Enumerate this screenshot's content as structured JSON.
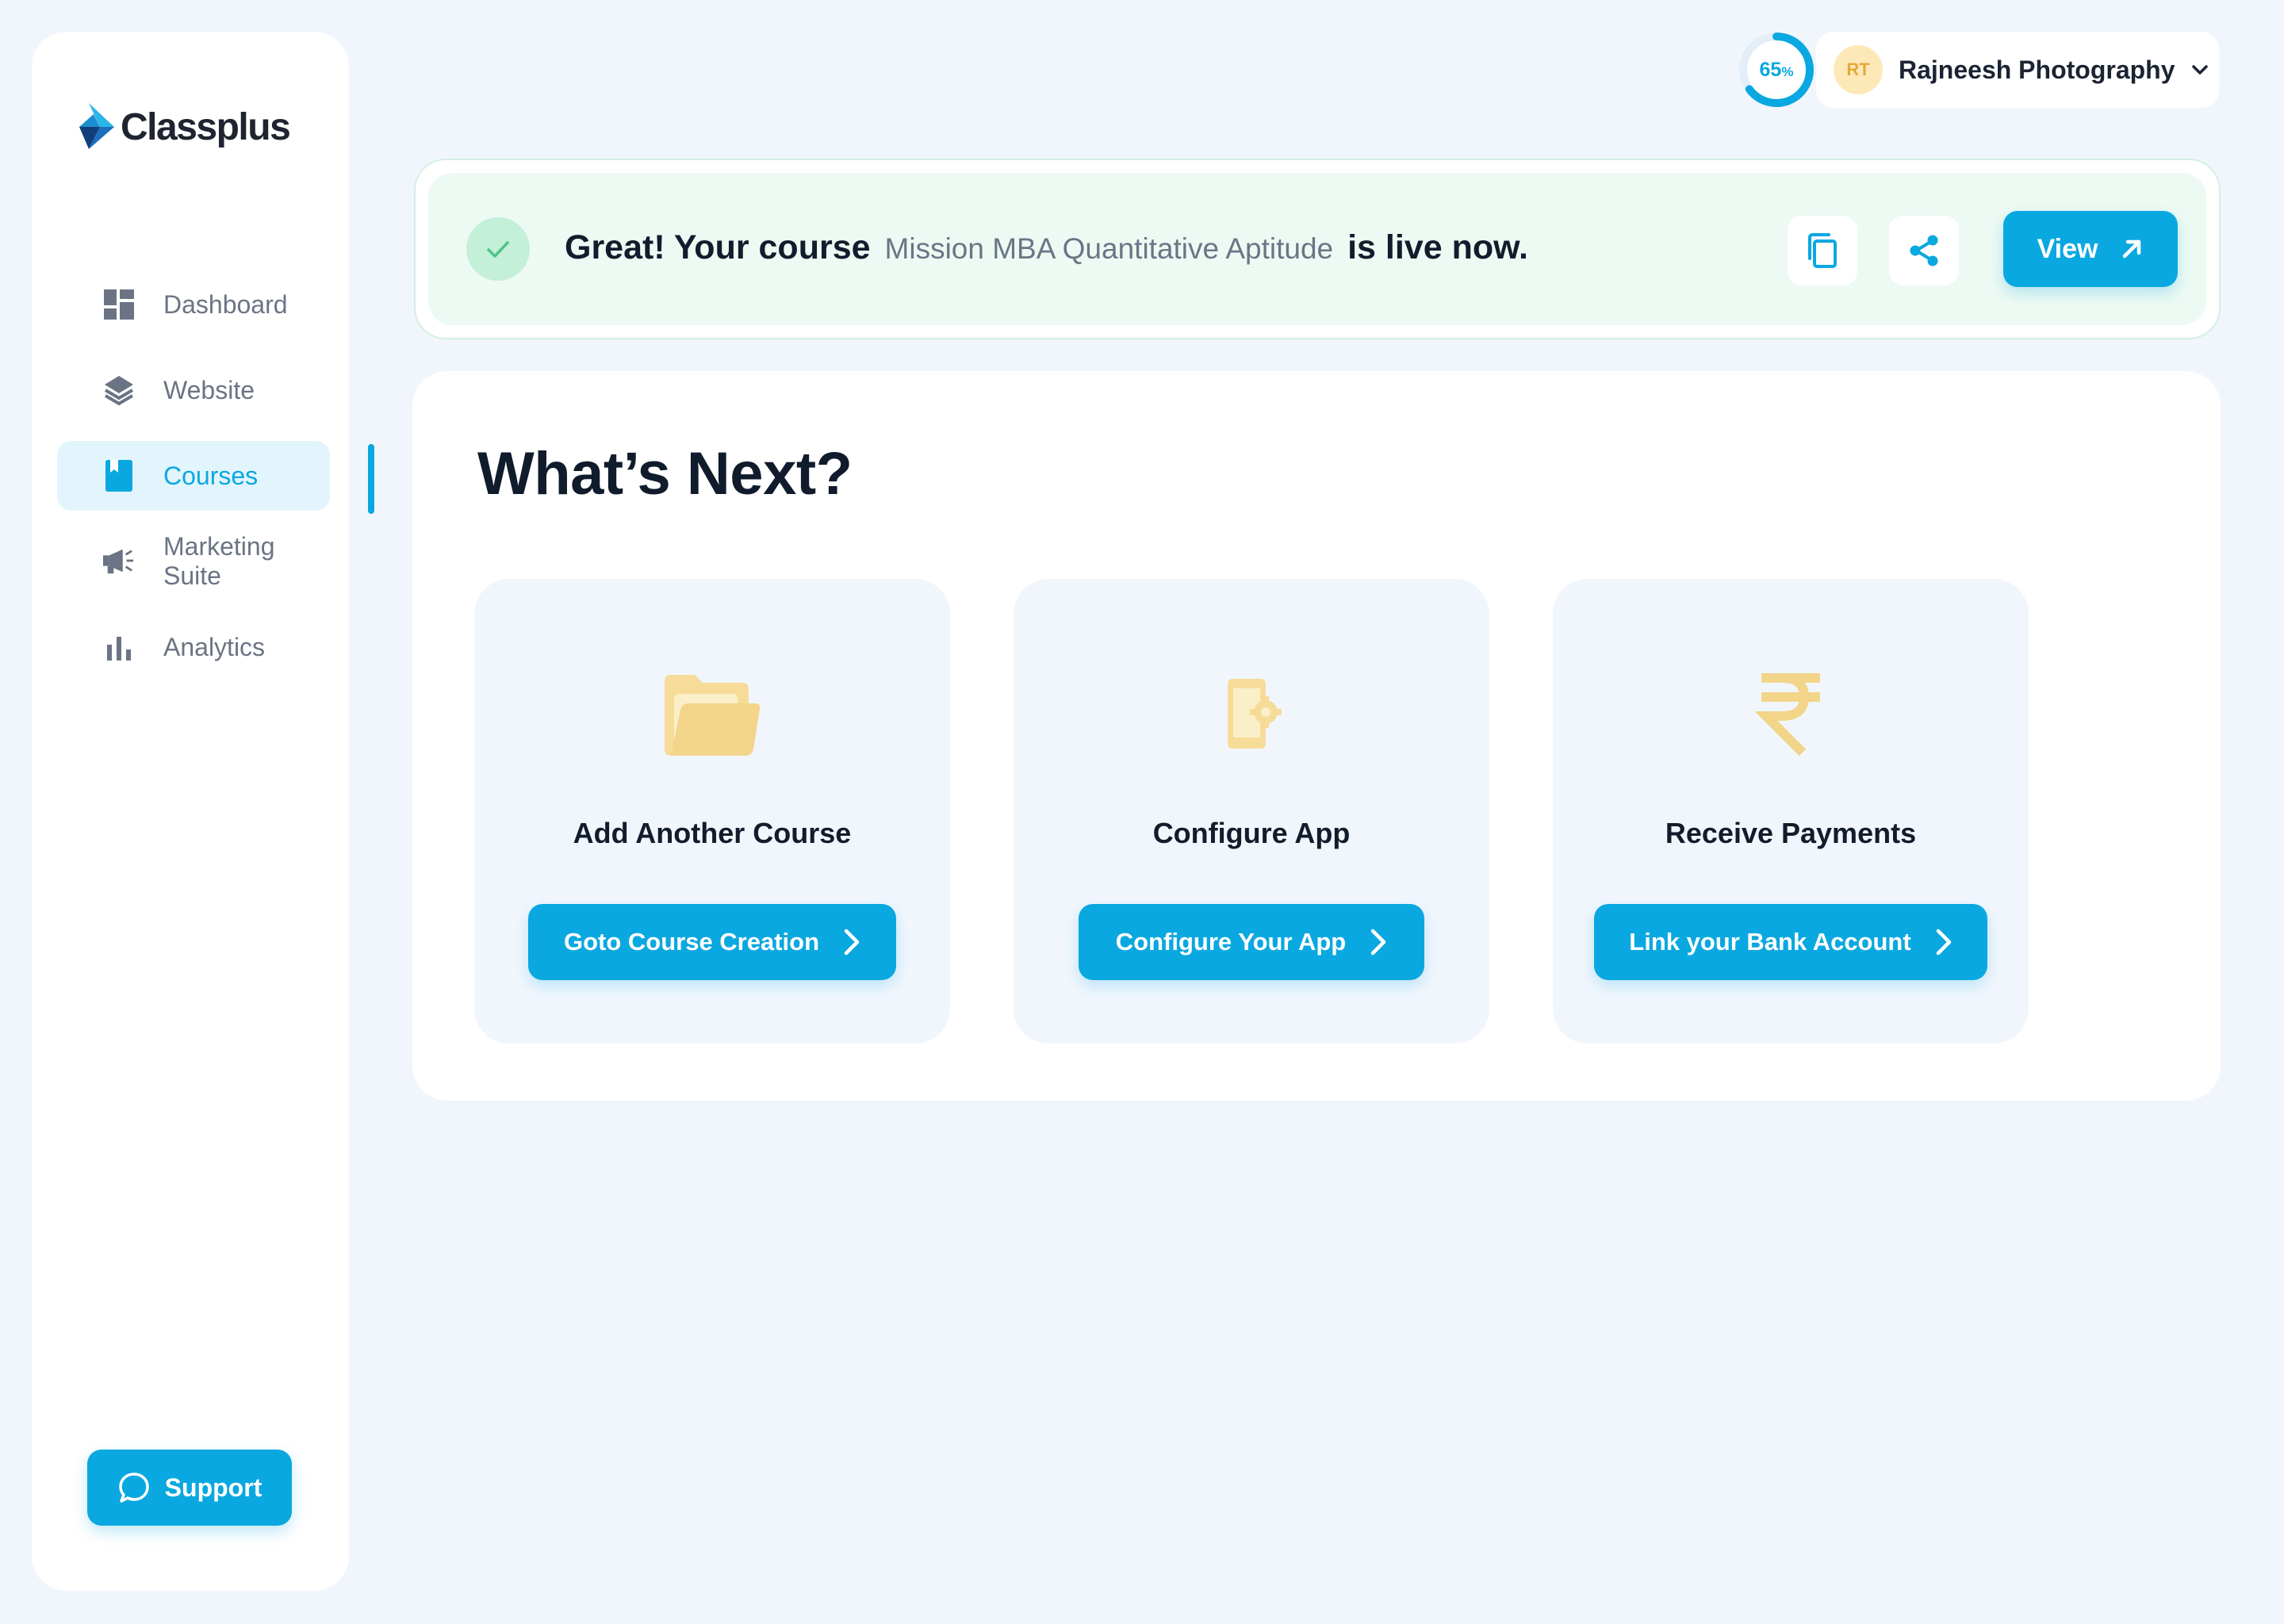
{
  "app": {
    "brand": "Classplus"
  },
  "sidebar": {
    "items": [
      {
        "label": "Dashboard",
        "icon": "dashboard-icon"
      },
      {
        "label": "Website",
        "icon": "layers-icon"
      },
      {
        "label": "Courses",
        "icon": "book-icon",
        "active": true
      },
      {
        "label": "Marketing Suite",
        "icon": "megaphone-icon"
      },
      {
        "label": "Analytics",
        "icon": "bar-chart-icon"
      }
    ],
    "support_label": "Support"
  },
  "header": {
    "progress_value": "65",
    "progress_unit": "%",
    "progress_fraction": 0.65,
    "user_initials": "RT",
    "user_name": "Rajneesh Photography"
  },
  "banner": {
    "prefix": "Great! Your course",
    "course_name": "Mission MBA Quantitative Aptitude",
    "suffix": "is live now.",
    "view_label": "View"
  },
  "next": {
    "title": "What’s Next?",
    "cards": [
      {
        "title": "Add Another Course",
        "button": "Goto Course Creation",
        "icon": "folder-icon"
      },
      {
        "title": "Configure App",
        "button": "Configure Your App",
        "icon": "phone-settings-icon"
      },
      {
        "title": "Receive Payments",
        "button": "Link your Bank Account",
        "icon": "rupee-icon"
      }
    ]
  },
  "colors": {
    "accent": "#0aa8e0",
    "success_bg": "#edfaf3",
    "icon_yellow": "#f6dc98",
    "page_bg": "#f1f6fd"
  }
}
